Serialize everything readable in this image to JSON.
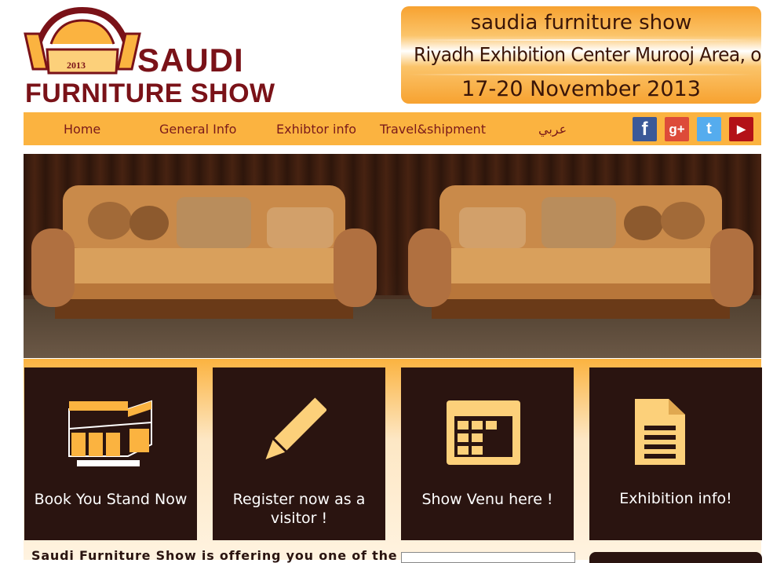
{
  "logo": {
    "year": "2013",
    "line1": "SAUDI",
    "line2": "FURNITURE SHOW"
  },
  "banner": {
    "line1": "saudia furniture show",
    "line2": "Riyadh Exhibition Center Murooj Area, olaya sreet",
    "line3": "17-20 November 2013"
  },
  "nav": {
    "items": [
      "Home",
      "General Info",
      "Exhibtor info",
      "Travel&shipment",
      "عربي"
    ]
  },
  "social": [
    {
      "name": "facebook",
      "glyph": "f",
      "color": "#3b5998"
    },
    {
      "name": "google-plus",
      "glyph": "g+",
      "color": "#dd4b39"
    },
    {
      "name": "twitter",
      "glyph": "t",
      "color": "#55acee"
    },
    {
      "name": "youtube",
      "glyph": "▶",
      "color": "#b31217"
    }
  ],
  "tiles": [
    {
      "label": "Book You Stand Now",
      "icon": "booth-icon"
    },
    {
      "label": "Register now as a visitor !",
      "icon": "pencil-icon"
    },
    {
      "label": "Show Venu here !",
      "icon": "calendar-icon"
    },
    {
      "label": "Exhibition info!",
      "icon": "document-icon"
    }
  ],
  "intro": {
    "text": "Saudi Furniture Show is offering you one of the"
  },
  "colors": {
    "brand": "#7a1218",
    "nav": "#fbb340",
    "tile": "#2a1410",
    "accent": "#f7a230"
  }
}
